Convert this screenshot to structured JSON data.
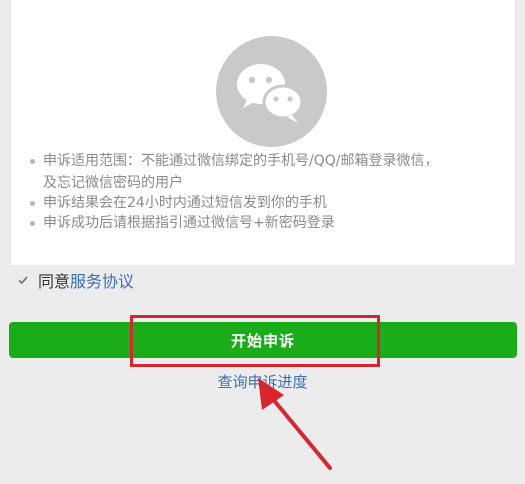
{
  "notes": [
    "申诉适用范围：不能通过微信绑定的手机号/QQ/邮箱登录微信，",
    "及忘记微信密码的用户",
    "申诉结果会在24小时内通过短信发到你的手机",
    "申诉成功后请根据指引通过微信号+新密码登录"
  ],
  "agreement": {
    "checked": true,
    "label": "同意",
    "link": "服务协议"
  },
  "actions": {
    "start_label": "开始申诉",
    "query_label": "查询申诉进度"
  },
  "colors": {
    "primary_button": "#1aad19",
    "link": "#3b6fb6",
    "annotation": "#d9252d"
  },
  "icons": [
    "wechat-logo-icon",
    "checkmark-icon",
    "annotation-arrow-icon"
  ]
}
